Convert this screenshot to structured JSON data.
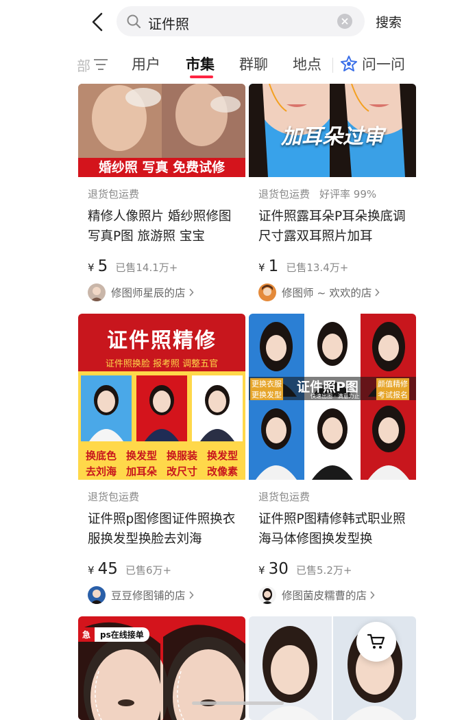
{
  "search": {
    "query": "证件照",
    "submit_label": "搜索"
  },
  "tabs": {
    "partial_label": "部",
    "items": [
      {
        "label": "用户"
      },
      {
        "label": "市集"
      },
      {
        "label": "群聊"
      },
      {
        "label": "地点"
      }
    ],
    "active_index": 1,
    "ask_label": "问一问"
  },
  "products": [
    {
      "banner": "婚纱照 写真 免费试修",
      "tags": [
        "退货包运费"
      ],
      "title": "精修人像照片 婚纱照修图 写真P图  旅游照 宝宝",
      "currency": "¥",
      "price": "5",
      "sold": "已售14.1万+",
      "shop": "修图师星辰的店"
    },
    {
      "banner": "加耳朵过审",
      "tags": [
        "退货包运费",
        "好评率 99%"
      ],
      "title": "证件照露耳朵P耳朵换底调尺寸露双耳照片加耳",
      "currency": "¥",
      "price": "1",
      "sold": "已售13.4万+",
      "shop": "修图师 ~ 欢欢的店"
    },
    {
      "banner_title": "证件照精修",
      "banner_subtitle": "证件照换脸 报考照 调整五官",
      "banner_labels": [
        "换底色",
        "换发型",
        "换服装",
        "换发型",
        "去刘海",
        "加耳朵",
        "改尺寸",
        "改像素"
      ],
      "tags": [
        "退货包运费"
      ],
      "title": "证件照p图修图证件照换衣服换发型换脸去刘海",
      "currency": "¥",
      "price": "45",
      "sold": "已售6万+",
      "shop": "豆豆修图铺的店"
    },
    {
      "banner_title": "证件照P图",
      "banner_subtitle": "快速出图 · 满意为止",
      "banner_labels": [
        "更换衣服",
        "更换发型",
        "颜值精修",
        "考试报名"
      ],
      "tags": [
        "退货包运费"
      ],
      "title": "证件照P图精修韩式职业照海马体修图换发型换",
      "currency": "¥",
      "price": "30",
      "sold": "已售5.2万+",
      "shop": "修图菌皮糯曹的店"
    },
    {
      "badge_icon": "急",
      "badge_text": "ps在线接单"
    },
    {}
  ],
  "colors": {
    "accent": "#ff2442",
    "banner_red": "#c8161d",
    "banner_yellow": "#ffd84a"
  }
}
